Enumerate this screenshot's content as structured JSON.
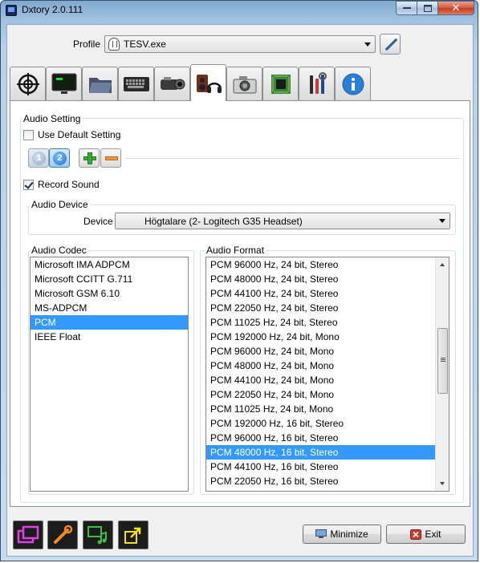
{
  "window": {
    "title": "Dxtory 2.0.111",
    "close_glyph": "✕"
  },
  "profile": {
    "label": "Profile",
    "value": "TESV.exe",
    "icon": "mask-icon"
  },
  "tabs": [
    {
      "icon": "crosshair-icon",
      "active": false
    },
    {
      "icon": "monitor-icon",
      "active": false
    },
    {
      "icon": "folder-icon",
      "active": false
    },
    {
      "icon": "keyboard-icon",
      "active": false
    },
    {
      "icon": "camcorder-icon",
      "active": false
    },
    {
      "icon": "speaker-headphones-icon",
      "active": true
    },
    {
      "icon": "camera-icon",
      "active": false
    },
    {
      "icon": "chip-icon",
      "active": false
    },
    {
      "icon": "tools-icon",
      "active": false
    },
    {
      "icon": "info-icon",
      "active": false
    }
  ],
  "audio_setting": {
    "title": "Audio Setting",
    "use_default_label": "Use Default Setting",
    "use_default_checked": false,
    "streams": [
      "1",
      "2"
    ],
    "selected_stream": "2",
    "record_sound_label": "Record Sound",
    "record_sound_checked": true
  },
  "audio_device": {
    "title": "Audio Device",
    "device_label": "Device",
    "device_value": "Högtalare (2- Logitech G35 Headset)"
  },
  "audio_codec": {
    "title": "Audio Codec",
    "items": [
      "Microsoft IMA ADPCM",
      "Microsoft CCITT G.711",
      "Microsoft GSM 6.10",
      "MS-ADPCM",
      "PCM",
      "IEEE Float"
    ],
    "selected": "PCM"
  },
  "audio_format": {
    "title": "Audio Format",
    "items": [
      "PCM 96000 Hz, 24 bit, Stereo",
      "PCM 48000 Hz, 24 bit, Stereo",
      "PCM 44100 Hz, 24 bit, Stereo",
      "PCM 22050 Hz, 24 bit, Stereo",
      "PCM 11025 Hz, 24 bit, Stereo",
      "PCM 192000 Hz, 24 bit, Mono",
      "PCM 96000 Hz, 24 bit, Mono",
      "PCM 48000 Hz, 24 bit, Mono",
      "PCM 44100 Hz, 24 bit, Mono",
      "PCM 22050 Hz, 24 bit, Mono",
      "PCM 11025 Hz, 24 bit, Mono",
      "PCM 192000 Hz, 16 bit, Stereo",
      "PCM 96000 Hz, 16 bit, Stereo",
      "PCM 48000 Hz, 16 bit, Stereo",
      "PCM 44100 Hz, 16 bit, Stereo",
      "PCM 22050 Hz, 16 bit, Stereo"
    ],
    "selected": "PCM 48000 Hz, 16 bit, Stereo"
  },
  "bottom": {
    "icons": [
      "windows-icon",
      "wrench-icon",
      "music-monitor-icon",
      "export-icon"
    ],
    "minimize_label": "Minimize",
    "exit_label": "Exit"
  },
  "colors": {
    "selection": "#3399ff",
    "accent_pink": "#e040e0",
    "accent_orange": "#f08a1c",
    "accent_green": "#40c040",
    "accent_yellow": "#f0e020"
  }
}
